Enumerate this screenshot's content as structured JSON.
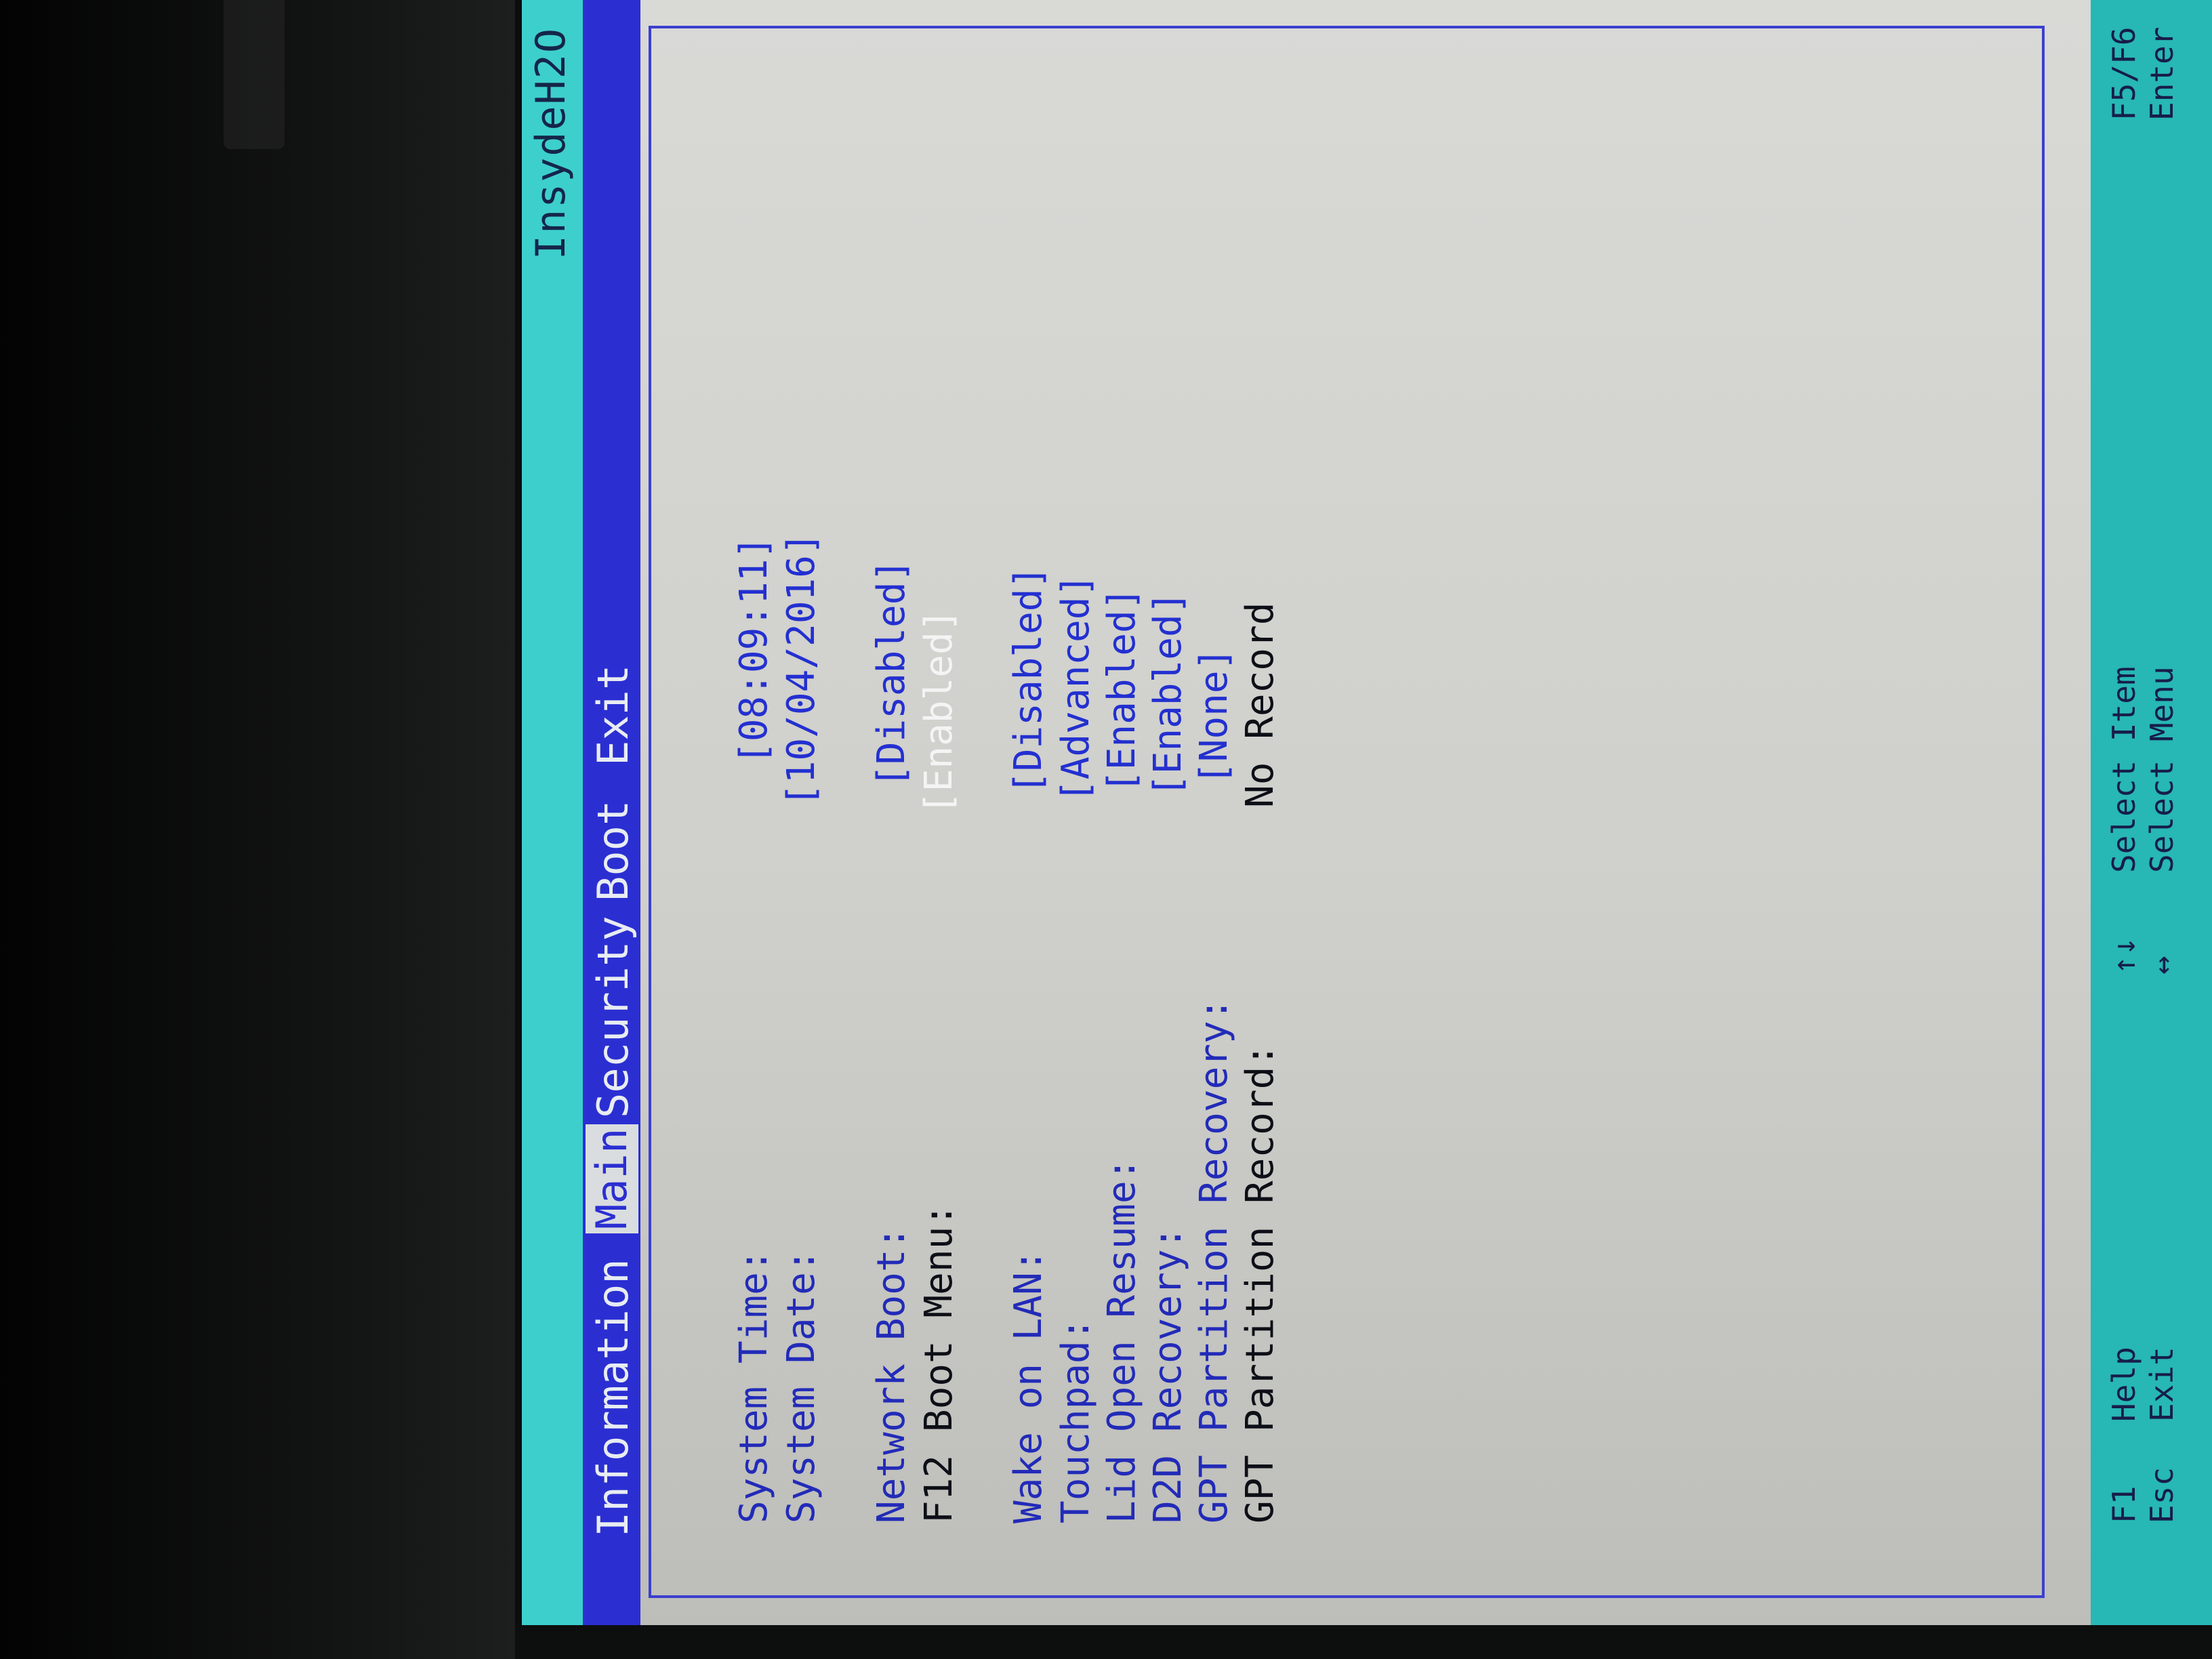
{
  "vendor_title": "InsydeH2O",
  "tabs": [
    {
      "label": "Information",
      "active": false
    },
    {
      "label": "Main",
      "active": true
    },
    {
      "label": "Security",
      "active": false
    },
    {
      "label": "Boot",
      "active": false
    },
    {
      "label": "Exit",
      "active": false
    }
  ],
  "settings": [
    {
      "label": "System Time:",
      "value": "[08:09:11]"
    },
    {
      "label": "System Date:",
      "value": "[10/04/2016]"
    },
    {
      "label": "Network Boot:",
      "value": "[Disabled]"
    },
    {
      "label": "F12 Boot Menu:",
      "value": "[Enabled]",
      "selected": true
    },
    {
      "label": "Wake on LAN:",
      "value": "[Disabled]"
    },
    {
      "label": "Touchpad:",
      "value": "[Advanced]"
    },
    {
      "label": "Lid Open Resume:",
      "value": "[Enabled]"
    },
    {
      "label": "D2D Recovery:",
      "value": "[Enabled]"
    },
    {
      "label": "GPT Partition Recovery:",
      "value": "[None]"
    },
    {
      "label": "GPT Partition Record:",
      "value": "No Record"
    }
  ],
  "help_keys": [
    {
      "key": "F1",
      "action": "Help"
    },
    {
      "key": "Esc",
      "action": "Exit"
    },
    {
      "key": "↑↓",
      "action": "Select Item"
    },
    {
      "key": "↔",
      "action": "Select Menu"
    },
    {
      "key": "F5/F6",
      "action": ""
    },
    {
      "key": "Enter",
      "action": ""
    }
  ],
  "colors": {
    "menu_bar": "#2b2fd2",
    "title_bar": "#3dcfcc",
    "help_bar": "#27b7b4",
    "content_bg": "#d2d2ce",
    "value_text": "#2330d0"
  }
}
